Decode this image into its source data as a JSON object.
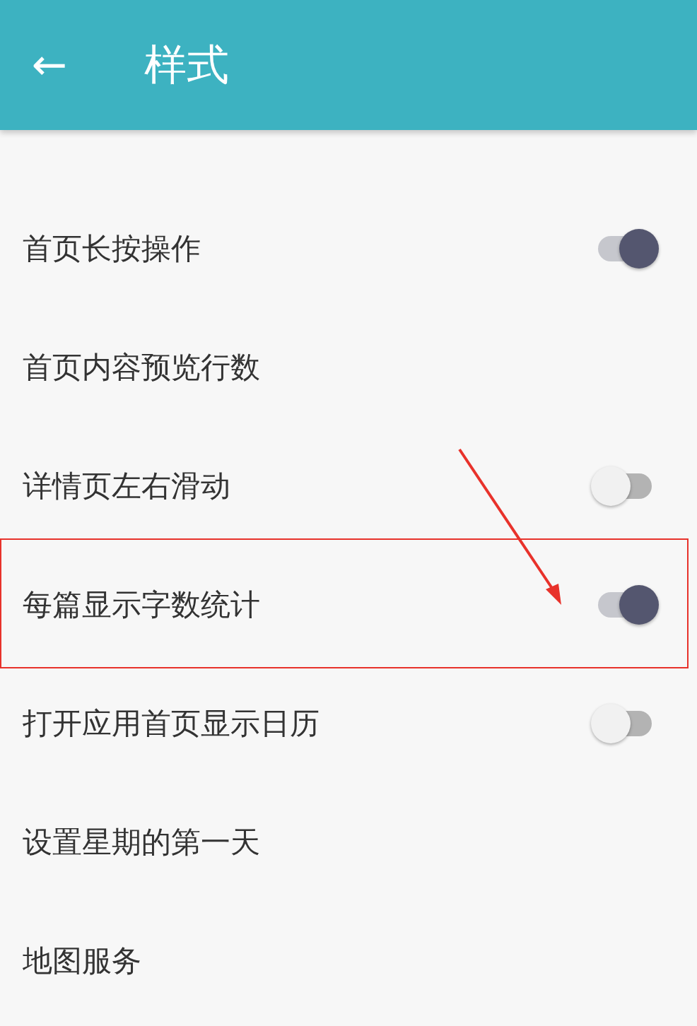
{
  "app_bar": {
    "back": "←",
    "title": "样式"
  },
  "items": [
    {
      "label": "首页长按操作",
      "kind": "toggle",
      "on": true,
      "highlighted": false
    },
    {
      "label": "首页内容预览行数",
      "kind": "plain",
      "highlighted": false
    },
    {
      "label": "详情页左右滑动",
      "kind": "toggle",
      "on": false,
      "highlighted": false
    },
    {
      "label": "每篇显示字数统计",
      "kind": "toggle",
      "on": true,
      "highlighted": true
    },
    {
      "label": "打开应用首页显示日历",
      "kind": "toggle",
      "on": false,
      "highlighted": false
    },
    {
      "label": "设置星期的第一天",
      "kind": "plain",
      "highlighted": false
    },
    {
      "label": "地图服务",
      "kind": "plain",
      "highlighted": false
    }
  ]
}
